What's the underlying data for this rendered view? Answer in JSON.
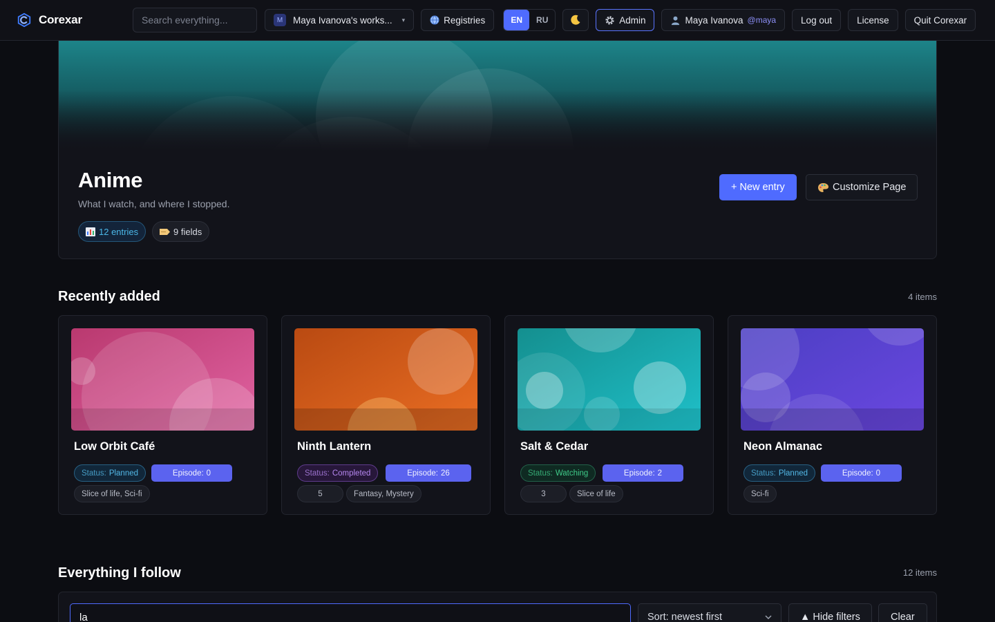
{
  "topbar": {
    "app_name": "Corexar",
    "search_placeholder": "Search everything...",
    "workspace_initial": "M",
    "workspace_label": "Maya Ivanova's works...",
    "registries_label": "Registries",
    "lang_en": "EN",
    "lang_ru": "RU",
    "admin_label": "Admin",
    "user_name": "Maya Ivanova",
    "user_handle": "@maya",
    "logout_label": "Log out",
    "license_label": "License",
    "quit_label": "Quit Corexar",
    "accent_color": "#4f6bff"
  },
  "hero": {
    "title": "Anime",
    "subtitle": "What I watch, and where I stopped.",
    "entries_label": "12 entries",
    "fields_label": "9 fields",
    "new_entry_label": "+ New entry",
    "customize_label": "Customize Page"
  },
  "recent": {
    "title": "Recently added",
    "count": "4 items",
    "status_key": "Status:",
    "episode_key": "Episode:",
    "cards": [
      {
        "title": "Low Orbit Café",
        "status": "Planned",
        "episode": "0",
        "tags": [
          "Slice of life, Sci-fi"
        ],
        "colors": [
          "#b9396f",
          "#e163a2"
        ]
      },
      {
        "title": "Ninth Lantern",
        "status": "Completed",
        "episode": "26",
        "tags": [
          "5",
          "Fantasy, Mystery"
        ],
        "colors": [
          "#b94a12",
          "#ea6e23"
        ]
      },
      {
        "title": "Salt & Cedar",
        "status": "Watching",
        "episode": "2",
        "tags": [
          "3",
          "Slice of life"
        ],
        "colors": [
          "#148f8f",
          "#1fc0c9"
        ]
      },
      {
        "title": "Neon Almanac",
        "status": "Planned",
        "episode": "0",
        "tags": [
          "Sci-fi"
        ],
        "colors": [
          "#4c3fc3",
          "#6a47e0"
        ]
      }
    ]
  },
  "follow": {
    "title": "Everything I follow",
    "count": "12 items",
    "filter_value": "la",
    "sort_label": "Sort: newest first",
    "hide_filters_label": "▲ Hide filters",
    "clear_label": "Clear"
  }
}
